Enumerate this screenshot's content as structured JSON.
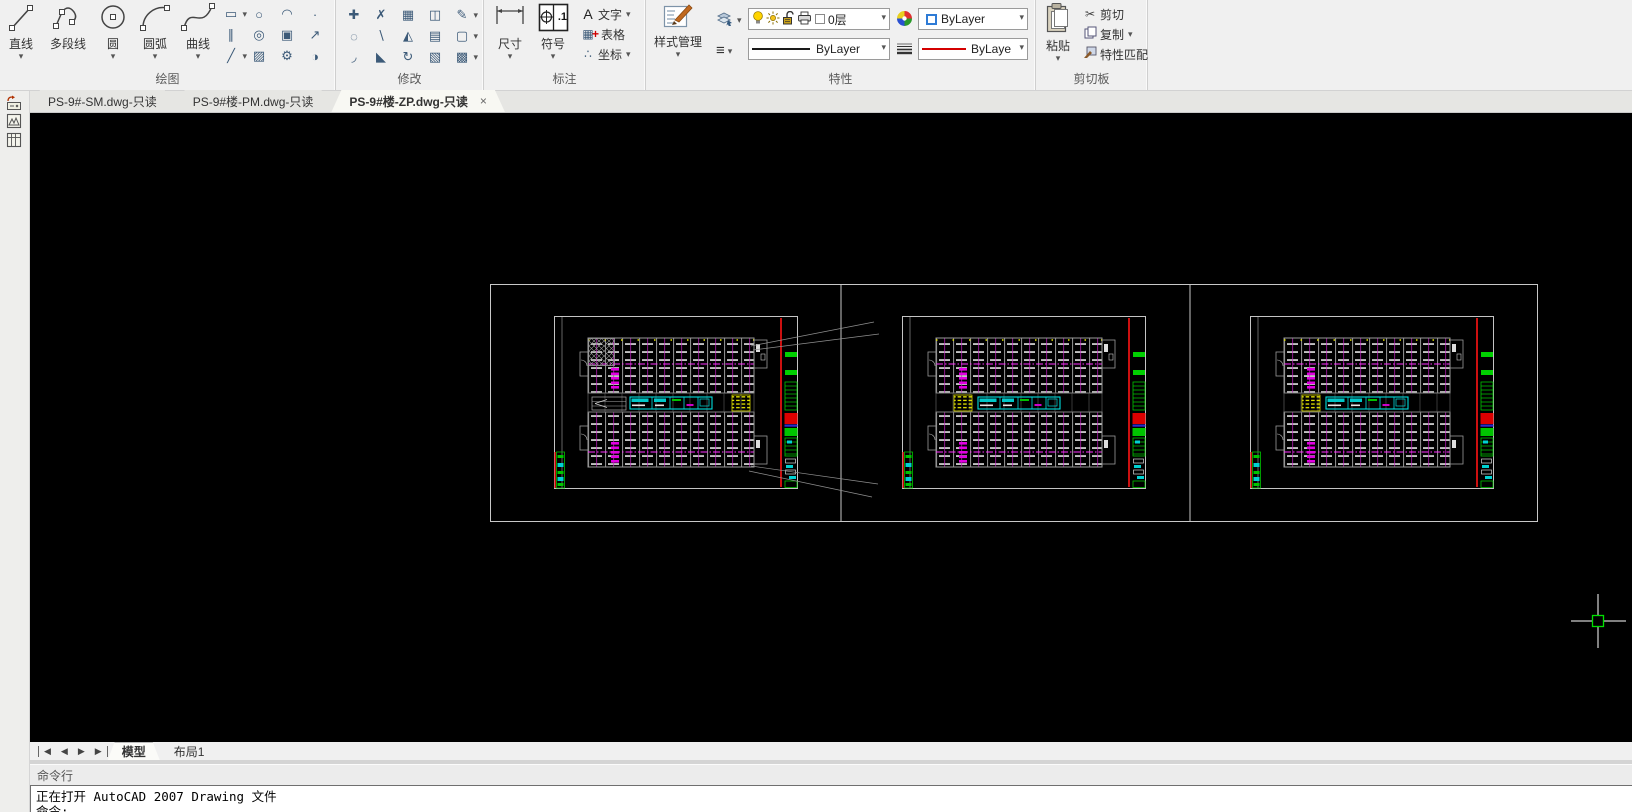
{
  "glyphs": {
    "caret": "▾",
    "close": "×",
    "nav_first": "◀",
    "nav_prev": "◀",
    "nav_next": "▶",
    "nav_last": "▶",
    "menu_lines": "≡",
    "text_letter": "A",
    "table_icon": "▦",
    "table_plus": "+",
    "coord_icon": "∴",
    "scissors": "✂"
  },
  "ribbon": {
    "draw": {
      "label": "绘图",
      "buttons": [
        {
          "label": "直线"
        },
        {
          "label": "多段线"
        },
        {
          "label": "圆"
        },
        {
          "label": "圆弧"
        },
        {
          "label": "曲线"
        }
      ],
      "grid": [
        {
          "name": "rectangle",
          "glyph": "▭"
        },
        {
          "name": "ellipse",
          "glyph": "○"
        },
        {
          "name": "arc-segment",
          "glyph": "◠"
        },
        {
          "name": "point",
          "glyph": "·"
        },
        {
          "name": "parallel-lines",
          "glyph": "∥"
        },
        {
          "name": "donut",
          "glyph": "◎"
        },
        {
          "name": "region",
          "glyph": "▣"
        },
        {
          "name": "pointer",
          "glyph": "↗"
        },
        {
          "name": "construction-line",
          "glyph": "╱"
        },
        {
          "name": "hatch",
          "glyph": "▨"
        },
        {
          "name": "gear",
          "glyph": "⚙"
        },
        {
          "name": "wipeout",
          "glyph": "◑"
        }
      ]
    },
    "modify": {
      "label": "修改",
      "grid": [
        {
          "name": "move",
          "glyph": "✚"
        },
        {
          "name": "trim",
          "glyph": "✗"
        },
        {
          "name": "array",
          "glyph": "▦"
        },
        {
          "name": "stretch",
          "glyph": "◫"
        },
        {
          "name": "edit-pencil",
          "glyph": "✎"
        },
        {
          "name": "scale",
          "glyph": "◌"
        },
        {
          "name": "offset",
          "glyph": "∖"
        },
        {
          "name": "mirror",
          "glyph": "◭"
        },
        {
          "name": "copy-object",
          "glyph": "▤"
        },
        {
          "name": "rectangle-edit",
          "glyph": "▢"
        },
        {
          "name": "fillet",
          "glyph": "◞"
        },
        {
          "name": "chamfer",
          "glyph": "◣"
        },
        {
          "name": "rotate",
          "glyph": "↻"
        },
        {
          "name": "solid-edit",
          "glyph": "▧"
        },
        {
          "name": "hatch-edit",
          "glyph": "▩"
        }
      ]
    },
    "annotate": {
      "label": "标注",
      "dimension": "尺寸",
      "symbol": "符号",
      "symbol_badge": ".1",
      "text": "文字",
      "table": "表格",
      "coordinate": "坐标"
    },
    "properties": {
      "label": "特性",
      "style_manager": "样式管理",
      "layer_value": "0层",
      "linetype_value": "ByLayer",
      "color_value": "ByLayer",
      "lineweight_value": "ByLayer"
    },
    "clipboard": {
      "label": "剪切板",
      "paste": "粘贴",
      "cut": "剪切",
      "copy": "复制",
      "match_properties": "特性匹配"
    }
  },
  "doc_tabs": [
    {
      "label": "PS-9#-SM.dwg-只读"
    },
    {
      "label": "PS-9#楼-PM.dwg-只读"
    },
    {
      "label": "PS-9#楼-ZP.dwg-只读"
    }
  ],
  "layout_tabs": {
    "model": "模型",
    "layout1": "布局1"
  },
  "command": {
    "title": "命令行",
    "lines": [
      "正在打开 AutoCAD 2007 Drawing 文件",
      "命令:"
    ]
  },
  "colors": {
    "canvas_bg": "#000000",
    "sheet_frame": "#c4c4c4",
    "plan_red": "#ff1414",
    "plan_green": "#00c400",
    "plan_magenta": "#e000e0",
    "plan_cyan": "#00dcdc",
    "plan_yellow": "#e8e800",
    "crosshair_box_green": "#00e000",
    "swatch_blue_border": "#2e7bd6",
    "lineweight_preview_red": "#d40000"
  }
}
